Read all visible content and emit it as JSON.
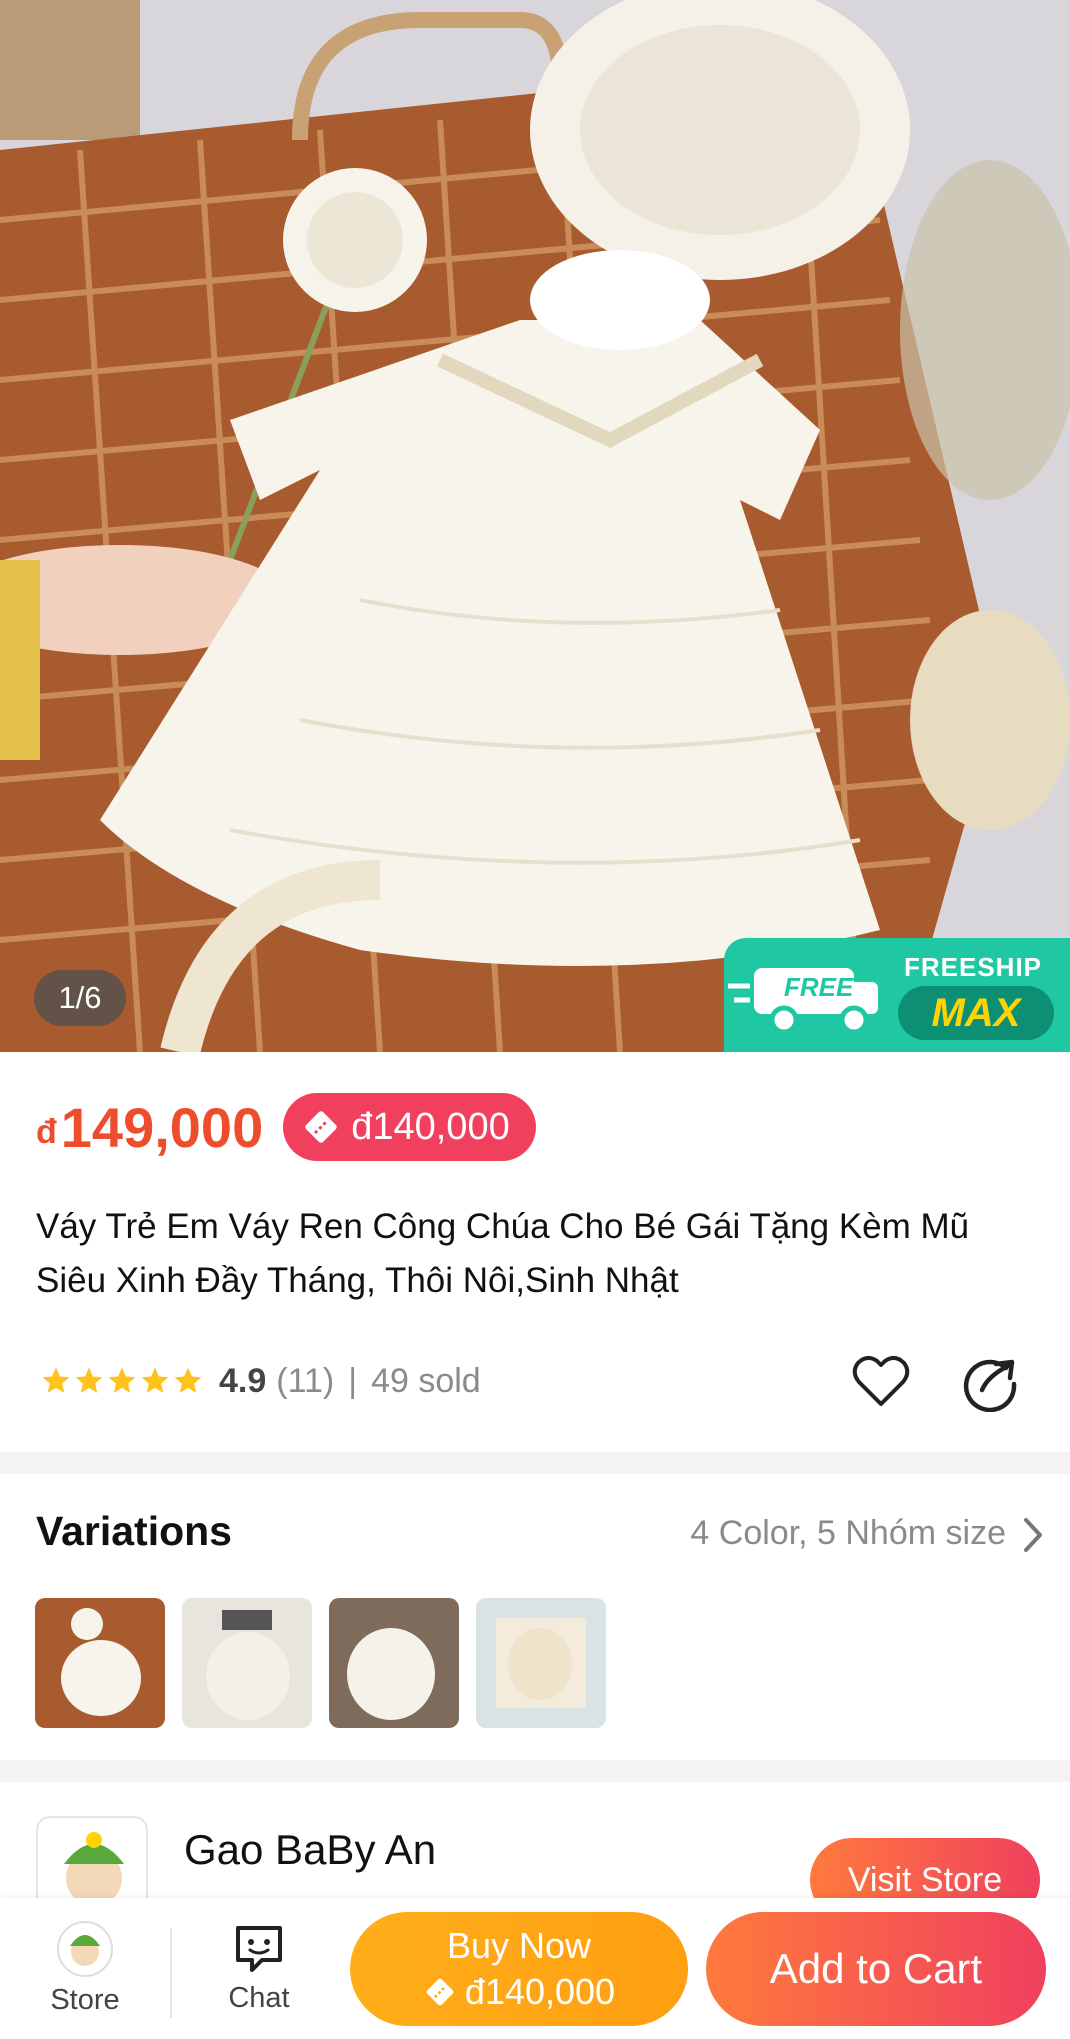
{
  "gallery": {
    "counter": "1/6",
    "badge_top": "FREESHIP",
    "badge_max": "MAX",
    "badge_free": "FREE"
  },
  "product": {
    "currency": "đ",
    "price": "149,000",
    "voucher_price": "đ140,000",
    "title": "Váy Trẻ Em Váy Ren Công Chúa Cho Bé Gái Tặng Kèm Mũ Siêu Xinh Đầy Tháng, Thôi Nôi,Sinh Nhật",
    "rating": "4.9",
    "reviews": "(11)",
    "separator": "|",
    "sold": "49 sold",
    "star_count": 5
  },
  "variations": {
    "title": "Variations",
    "summary": "4 Color, 5 Nhóm size"
  },
  "store": {
    "name": "Gao BaBy An",
    "visit_label": "Visit Store"
  },
  "bottom_bar": {
    "store_label": "Store",
    "chat_label": "Chat",
    "buy_label": "Buy Now",
    "buy_price": "đ140,000",
    "cart_label": "Add to Cart"
  },
  "colors": {
    "accent": "#ee4d2d",
    "voucher": "#f0405e",
    "buy": "#ffa516",
    "freeship": "#1fc7a3"
  }
}
